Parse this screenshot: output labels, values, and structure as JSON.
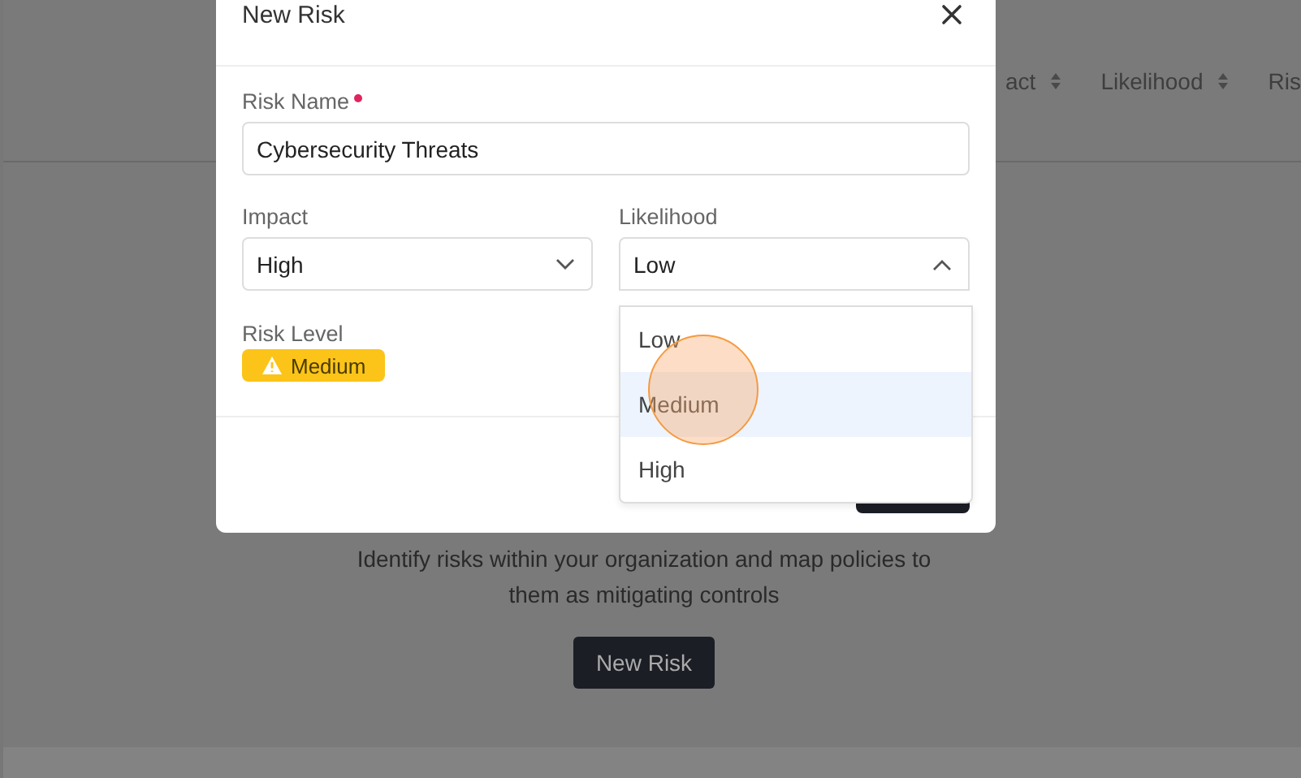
{
  "page": {
    "table_columns": [
      {
        "label": "act",
        "sortable": true
      },
      {
        "label": "Likelihood",
        "sortable": true
      },
      {
        "label": "Ris",
        "sortable": false
      }
    ],
    "empty_message": "Identify risks within your organization and map policies to them as mitigating controls",
    "new_button": "New Risk"
  },
  "dialog": {
    "title": "New Risk",
    "risk_name": {
      "label": "Risk Name",
      "required": true,
      "value": "Cybersecurity Threats"
    },
    "impact": {
      "label": "Impact",
      "value": "High",
      "expanded": false
    },
    "likelihood": {
      "label": "Likelihood",
      "value": "Low",
      "expanded": true,
      "options": [
        {
          "label": "Low",
          "hovered": false
        },
        {
          "label": "Medium",
          "hovered": true
        },
        {
          "label": "High",
          "hovered": false
        }
      ]
    },
    "risk_level": {
      "label": "Risk Level",
      "value": "Medium"
    }
  }
}
